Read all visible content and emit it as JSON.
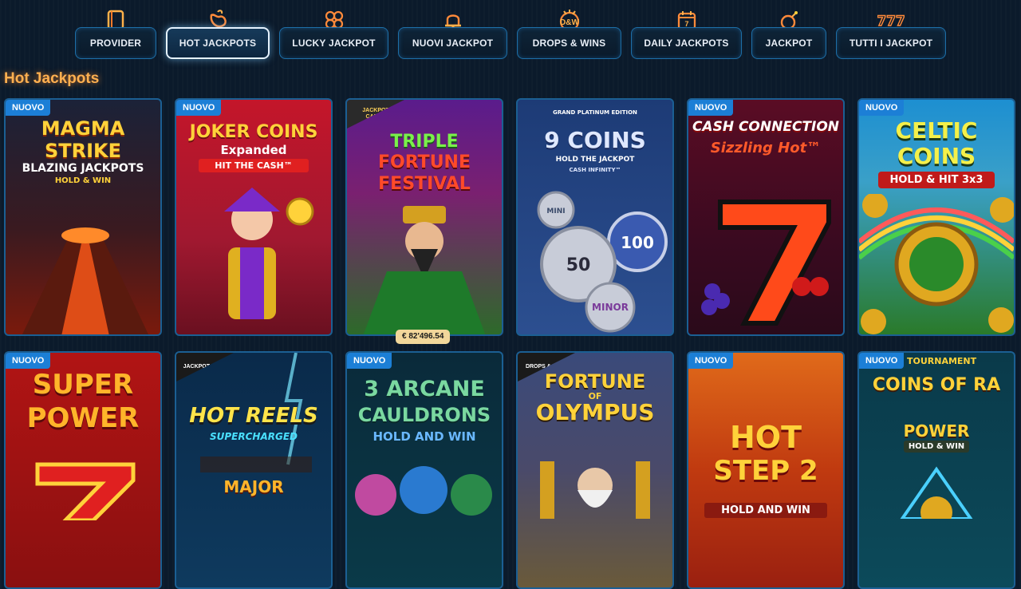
{
  "nav": {
    "items": [
      {
        "label": "PROVIDER",
        "icon": "book-icon",
        "active": false
      },
      {
        "label": "HOT JACKPOTS",
        "icon": "chili-pepper-icon",
        "active": true
      },
      {
        "label": "LUCKY JACKPOT",
        "icon": "clover-icon",
        "active": false
      },
      {
        "label": "NUOVI JACKPOT",
        "icon": "bell-icon",
        "active": false
      },
      {
        "label": "DROPS & WINS",
        "icon": "drops-wins-icon",
        "active": false
      },
      {
        "label": "DAILY JACKPOTS",
        "icon": "calendar-icon",
        "active": false
      },
      {
        "label": "JACKPOT",
        "icon": "bomb-icon",
        "active": false
      },
      {
        "label": "TUTTI I JACKPOT",
        "icon": "triple-seven-icon",
        "active": false
      }
    ]
  },
  "section": {
    "title": "Hot Jackpots"
  },
  "games": [
    {
      "title": "MAGMA STRIKE",
      "subtitle": "BLAZING JACKPOTS",
      "tagline": "HOLD & WIN",
      "badge": "NUOVO",
      "colors": {
        "top": "#1b2238",
        "bottom": "#7a1a0c",
        "title": "#ffd23a"
      }
    },
    {
      "title": "JOKER COINS",
      "subtitle": "Expanded",
      "tagline": "HIT THE CASH™",
      "badge": "NUOVO",
      "colors": {
        "top": "#c4162a",
        "bottom": "#6a1020",
        "title": "#ffd23a"
      }
    },
    {
      "title": "TRIPLE",
      "subtitle": "FORTUNE",
      "tagline": "FESTIVAL",
      "badge": "JACKPOT CARDS",
      "jackpot": "€ 82'496.54",
      "colors": {
        "top": "#5a1c8c",
        "bottom": "#2d6a2a",
        "title": "#ffd23a"
      }
    },
    {
      "title": "9 COINS",
      "subtitle": "HOLD THE JACKPOT",
      "tagline": "CASH INFINITY™",
      "badge": "GRAND PLATINUM EDITION",
      "coin_labels": [
        "MINI",
        "100",
        "50",
        "MINOR"
      ],
      "colors": {
        "top": "#1d3b76",
        "bottom": "#2c4f90",
        "title": "#dfe8ff"
      }
    },
    {
      "title": "CASH CONNECTION",
      "subtitle": "Sizzling Hot™",
      "tagline": "",
      "badge": "NUOVO",
      "colors": {
        "top": "#5a0c24",
        "bottom": "#2a0a1a",
        "title": "#ff5a2a"
      }
    },
    {
      "title": "CELTIC",
      "subtitle": "COINS",
      "tagline": "HOLD & HIT 3x3",
      "badge": "NUOVO",
      "colors": {
        "top": "#1d8fd1",
        "bottom": "#2a7a2a",
        "title": "#f4f04a"
      }
    },
    {
      "title": "SUPER",
      "subtitle": "POWER",
      "tagline": "",
      "badge": "NUOVO",
      "colors": {
        "top": "#b11414",
        "bottom": "#7a0c0c",
        "title": "#ffb52a"
      }
    },
    {
      "title": "HOT REELS",
      "subtitle": "SUPERCHARGED",
      "tagline": "MAJOR",
      "badge": "JACKPOT HUNT",
      "colors": {
        "top": "#0a2a4a",
        "bottom": "#0a3a5a",
        "title": "#ffe44a"
      }
    },
    {
      "title": "3 ARCANE",
      "subtitle": "CAULDRONS",
      "tagline": "HOLD AND WIN",
      "badge": "NUOVO",
      "colors": {
        "top": "#0a2a3a",
        "bottom": "#0a4a4a",
        "title": "#7ad8a0"
      }
    },
    {
      "title": "FORTUNE",
      "subtitle": "OLYMPUS",
      "tagline": "OF",
      "badge": "DROPS & WINS",
      "colors": {
        "top": "#3a4a7a",
        "bottom": "#6a5a3a",
        "title": "#ffd23a"
      }
    },
    {
      "title": "HOT",
      "subtitle": "STEP 2",
      "tagline": "HOLD AND WIN",
      "badge": "NUOVO",
      "colors": {
        "top": "#e06a1a",
        "bottom": "#9a2010",
        "title": "#ffd23a"
      }
    },
    {
      "title": "COINS OF RA",
      "subtitle": "POWER",
      "tagline": "HOLD & WIN",
      "badge": "NUOVO",
      "extra": "TOURNAMENT",
      "colors": {
        "top": "#0a3a4a",
        "bottom": "#0a4a5a",
        "title": "#ffd23a"
      }
    }
  ]
}
